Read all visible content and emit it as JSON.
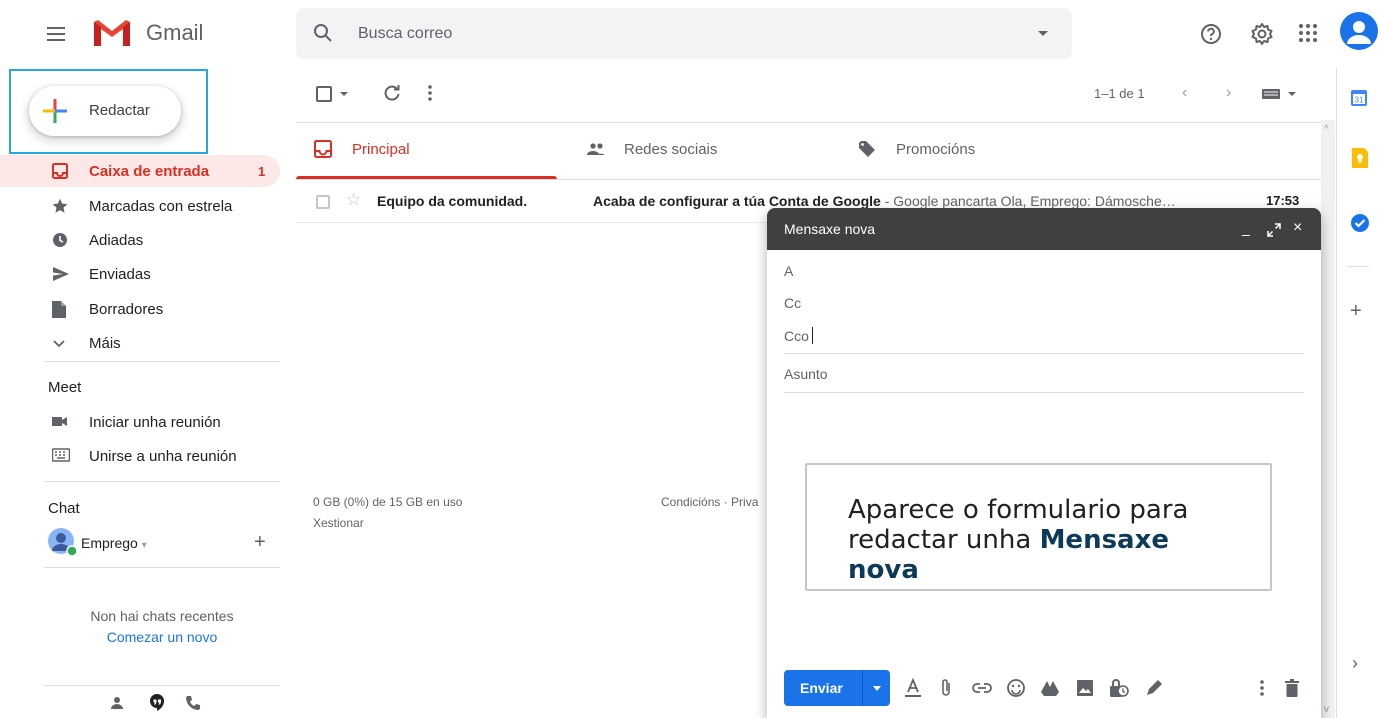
{
  "header": {
    "brand": "Gmail",
    "search_placeholder": "Busca correo"
  },
  "sidebar": {
    "compose_label": "Redactar",
    "items": [
      {
        "label": "Caixa de entrada",
        "count": "1",
        "icon": "inbox-icon",
        "active": true
      },
      {
        "label": "Marcadas con estrela",
        "icon": "star-icon"
      },
      {
        "label": "Adiadas",
        "icon": "clock-icon"
      },
      {
        "label": "Enviadas",
        "icon": "send-icon"
      },
      {
        "label": "Borradores",
        "icon": "draft-icon"
      },
      {
        "label": "Máis",
        "icon": "chevron-down-icon"
      }
    ],
    "meet": {
      "title": "Meet",
      "items": [
        {
          "label": "Iniciar unha reunión",
          "icon": "video-icon"
        },
        {
          "label": "Unirse a unha reunión",
          "icon": "keyboard-icon"
        }
      ]
    },
    "chat": {
      "title": "Chat",
      "user": "Emprego",
      "empty": "Non hai chats recentes",
      "start_link": "Comezar un novo"
    }
  },
  "toolbar": {
    "pager": "1–1 de 1"
  },
  "tabs": [
    {
      "label": "Principal",
      "icon": "inbox-icon",
      "active": true
    },
    {
      "label": "Redes sociais",
      "icon": "people-icon"
    },
    {
      "label": "Promocións",
      "icon": "tag-icon"
    }
  ],
  "emails": [
    {
      "sender": "Equipo da comunidad.",
      "subject": "Acaba de configurar a túa Conta de Google",
      "snippet": " - Google pancarta Ola, Emprego: Dámosche…",
      "time": "17:53"
    }
  ],
  "footer": {
    "storage": "0 GB (0%) de 15 GB en uso",
    "manage": "Xestionar",
    "terms": "Condicións · Priva"
  },
  "compose": {
    "title": "Mensaxe nova",
    "to_label": "A",
    "cc_label": "Cc",
    "bcc_label": "Cco",
    "subject_placeholder": "Asunto",
    "send_label": "Enviar"
  },
  "callout": {
    "text": "Aparece o formulario para redactar unha ",
    "bold": "Mensaxe nova"
  },
  "colors": {
    "accent_red": "#d93025",
    "send_blue": "#1a73e8",
    "compose_header": "#404040",
    "highlight_frame": "#29a8e0"
  }
}
